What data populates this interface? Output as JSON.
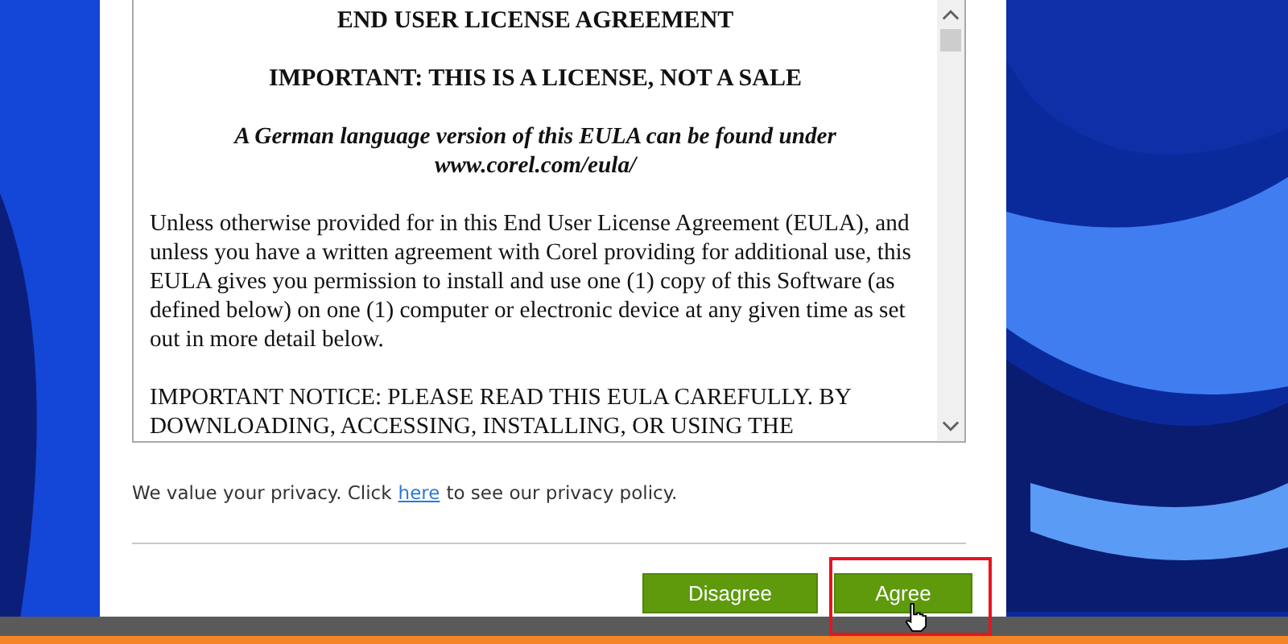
{
  "license": {
    "paragraphs": [
      {
        "kind": "heading",
        "text": "END USER LICENSE AGREEMENT"
      },
      {
        "kind": "heading",
        "text": "IMPORTANT: THIS IS A LICENSE, NOT A SALE"
      },
      {
        "kind": "note",
        "text": "A German language version of this EULA can be found under www.corel.com/eula/"
      },
      {
        "kind": "body",
        "text": "Unless otherwise provided for in this End User License Agreement (EULA), and unless you have a written agreement with Corel providing for additional use, this EULA gives you permission to install and use one (1) copy of this Software (as defined below) on one (1) computer or electronic device at any given time as set out in more detail below."
      },
      {
        "kind": "body",
        "text": "IMPORTANT NOTICE: PLEASE READ THIS EULA CAREFULLY. BY DOWNLOADING, ACCESSING, INSTALLING, OR USING THE"
      }
    ]
  },
  "privacy": {
    "before": "We value your privacy. Click",
    "link": "here",
    "after": "to see our privacy policy."
  },
  "buttons": [
    {
      "label": "Disagree",
      "highlighted": false
    },
    {
      "label": "Agree",
      "highlighted": true
    }
  ]
}
